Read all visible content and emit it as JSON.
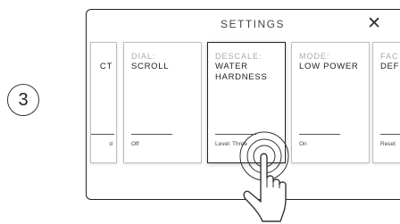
{
  "step_number": "3",
  "header": {
    "title": "SETTINGS",
    "close_glyph": "✕"
  },
  "cards": [
    {
      "label": "",
      "value": "CT",
      "status": "d"
    },
    {
      "label": "DIAL:",
      "value": "SCROLL",
      "status": "Off"
    },
    {
      "label": "DESCALE:",
      "value": "WATER HARDNESS",
      "status": "Level: Three"
    },
    {
      "label": "MODE:",
      "value": "LOW POWER",
      "status": "On"
    },
    {
      "label": "FAC",
      "value": "DEF",
      "status": "Reset"
    }
  ],
  "icons": {
    "close": "close-icon",
    "gesture": "hand-tap-icon"
  }
}
